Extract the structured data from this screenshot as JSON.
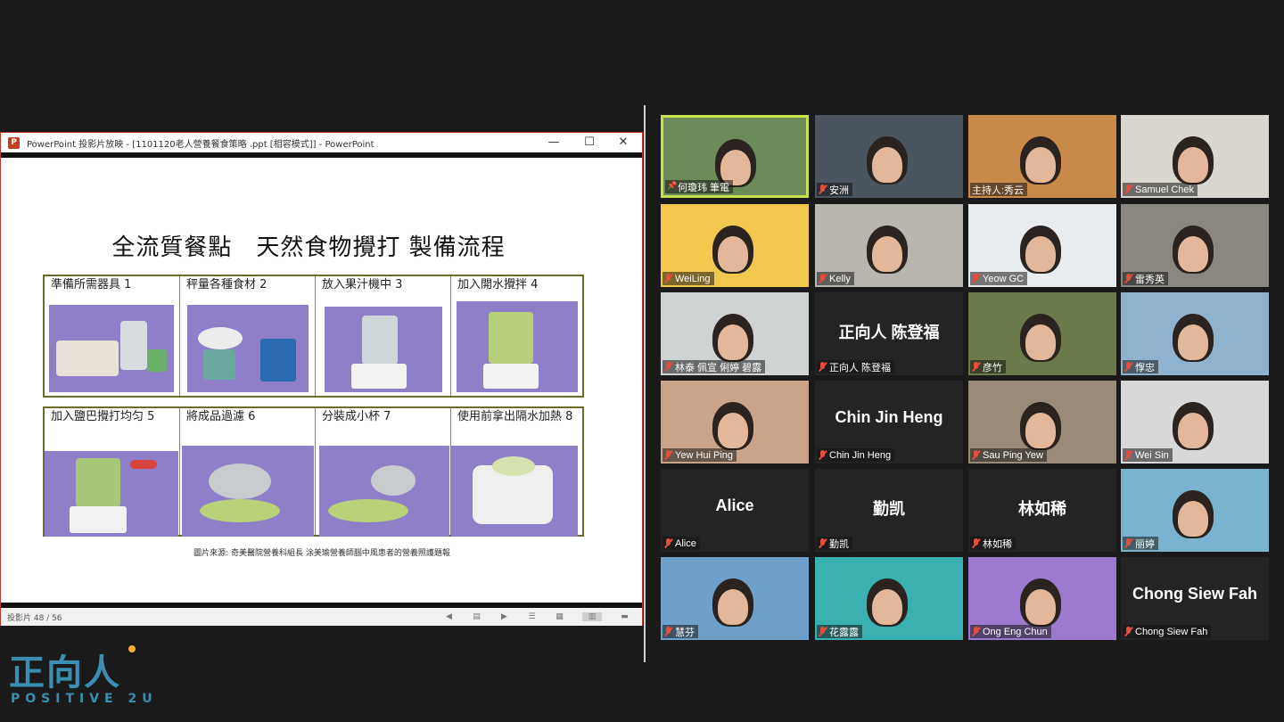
{
  "ppt": {
    "window_title": "PowerPoint 投影片放映 - [1101120老人營養餐食策略 .ppt [相容模式]] - PowerPoint",
    "logo_letter": "P",
    "min_glyph": "—",
    "max_glyph": "☐",
    "close_glyph": "✕",
    "slide_counter": "投影片 48 / 56",
    "status_icons": [
      "◀",
      "▤",
      "▶",
      "☰",
      "▦",
      "▥",
      "▬"
    ]
  },
  "slide": {
    "title": "全流質餐點　天然食物攪打 製備流程",
    "steps_top": [
      {
        "label": "準備所需器具 1"
      },
      {
        "label": "秤量各種食材 2"
      },
      {
        "label": "放入果汁機中 3"
      },
      {
        "label": "加入開水攪拌 4"
      }
    ],
    "steps_bottom": [
      {
        "label": "加入鹽巴攪打均匀 5"
      },
      {
        "label": "將成品過濾 6"
      },
      {
        "label": "分裝成小杯 7"
      },
      {
        "label": "使用前拿出隔水加熱 8"
      }
    ],
    "caption": "圖片來源: 奇美醫院營養科組長 涂美瑜營養師腦中風患者的營養照護題報"
  },
  "participants": [
    {
      "name": "何瓊玮 筆電",
      "type": "video",
      "speaking": true,
      "pinned": true,
      "muted": false,
      "bg": "#6d8a5a"
    },
    {
      "name": "安洲",
      "type": "video",
      "muted": true,
      "bg": "#4a5560"
    },
    {
      "name": "主持人:秀云",
      "type": "video",
      "muted": false,
      "bg": "#c98a4a"
    },
    {
      "name": "Samuel Chek",
      "type": "video",
      "muted": true,
      "bg": "#d9d6cf"
    },
    {
      "name": "WeiLing",
      "type": "video",
      "muted": true,
      "bg": "#f2c94c"
    },
    {
      "name": "Kelly",
      "type": "video",
      "muted": true,
      "bg": "#b9b6b0"
    },
    {
      "name": "Yeow GC",
      "type": "video",
      "muted": true,
      "bg": "#e9ecee"
    },
    {
      "name": "雷秀英",
      "type": "video",
      "muted": true,
      "bg": "#8a8680"
    },
    {
      "name": "林泰 佩宣 俐婷 碧露",
      "type": "video",
      "muted": true,
      "bg": "#cfd3d4"
    },
    {
      "name": "正向人 陈登福",
      "type": "text",
      "center": "正向人 陈登福",
      "muted": true
    },
    {
      "name": "彦竹",
      "type": "video",
      "muted": true,
      "bg": "#6b7a4a"
    },
    {
      "name": "惸忠",
      "type": "video",
      "muted": true,
      "bg": "#8fb3cf"
    },
    {
      "name": "Yew Hui Ping",
      "type": "video",
      "muted": true,
      "bg": "#c9a48a"
    },
    {
      "name": "Chin Jin Heng",
      "type": "text",
      "center": "Chin Jin Heng",
      "muted": true
    },
    {
      "name": "Sau Ping Yew",
      "type": "video",
      "muted": true,
      "bg": "#9a8a7a"
    },
    {
      "name": "Wei Sin",
      "type": "video",
      "muted": true,
      "bg": "#d8d8d8"
    },
    {
      "name": "Alice",
      "type": "text",
      "center": "Alice",
      "muted": true
    },
    {
      "name": "勤凯",
      "type": "text",
      "center": "勤凯",
      "muted": true
    },
    {
      "name": "林如稀",
      "type": "text",
      "center": "林如稀",
      "muted": true
    },
    {
      "name": "丽婷",
      "type": "video",
      "muted": true,
      "bg": "#7ab3cf"
    },
    {
      "name": "慧芬",
      "type": "video",
      "muted": true,
      "bg": "#6fa0c9"
    },
    {
      "name": "花露露",
      "type": "video",
      "muted": true,
      "bg": "#3ab0b0"
    },
    {
      "name": "Ong Eng Chun",
      "type": "video",
      "muted": true,
      "bg": "#9b7ad0"
    },
    {
      "name": "Chong Siew Fah",
      "type": "text",
      "center": "Chong Siew Fah",
      "muted": true
    }
  ],
  "brand": {
    "main": "正向人",
    "sub": "POSITIVE 2U",
    "color": "#3a8fb0"
  }
}
